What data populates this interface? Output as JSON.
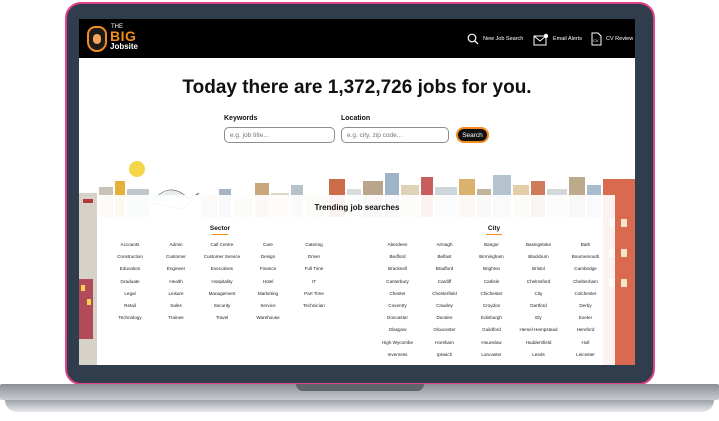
{
  "header": {
    "logo_the": "THE",
    "logo_big": "BIG",
    "logo_sub": "Jobsite",
    "nav": [
      {
        "label": "New Job Search",
        "icon": "search-icon"
      },
      {
        "label": "Email Alerts",
        "icon": "email-alert-icon"
      },
      {
        "label": "CV Review",
        "icon": "cv-document-icon"
      }
    ]
  },
  "hero": {
    "headline": "Today there are 1,372,726 jobs for you."
  },
  "search": {
    "keywords_label": "Keywords",
    "keywords_placeholder": "e.g. job title...",
    "location_label": "Location",
    "location_placeholder": "e.g. city, zip code...",
    "button_label": "Search"
  },
  "trending": {
    "title": "Trending job searches",
    "sector_heading": "Sector",
    "city_heading": "City",
    "sectors": [
      "Accounts",
      "Admin",
      "Call Centre",
      "Care",
      "Catering",
      "Construction",
      "Customer",
      "Customer Service",
      "Design",
      "Driver",
      "Education",
      "Engineer",
      "Executives",
      "Finance",
      "Full Time",
      "Graduate",
      "Health",
      "Hospitality",
      "Hotel",
      "IT",
      "Legal",
      "Leisure",
      "Management",
      "Marketing",
      "Part Time",
      "Retail",
      "Sales",
      "Security",
      "Service",
      "Technician",
      "Technology",
      "Trainee",
      "Travel",
      "Warehouse",
      ""
    ],
    "cities": [
      "Aberdeen",
      "Armagh",
      "Bangor",
      "Basingstoke",
      "Bath",
      "Bedford",
      "Belfast",
      "Birmingham",
      "Blackburn",
      "Bournemouth",
      "Bracknell",
      "Bradford",
      "Brighton",
      "Bristol",
      "Cambridge",
      "Canterbury",
      "Cardiff",
      "Carlisle",
      "Chelmsford",
      "Cheltenham",
      "Chester",
      "Chesterfield",
      "Chichester",
      "City",
      "Colchester",
      "Coventry",
      "Crawley",
      "Croydon",
      "Dartford",
      "Derby",
      "Doncaster",
      "Dundee",
      "Edinburgh",
      "Ely",
      "Exeter",
      "Glasgow",
      "Gloucester",
      "Guildford",
      "Hemel Hempstead",
      "Hereford",
      "High Wycombe",
      "Horsham",
      "Hounslow",
      "Huddersfield",
      "Hull",
      "Inverness",
      "Ipswich",
      "Lancaster",
      "Leeds",
      "Leicester"
    ]
  },
  "colors": {
    "accent": "#f28c1e",
    "header_bg": "#000000",
    "bezel": "#2f3d4d",
    "bezel_edge": "#e0428a"
  }
}
